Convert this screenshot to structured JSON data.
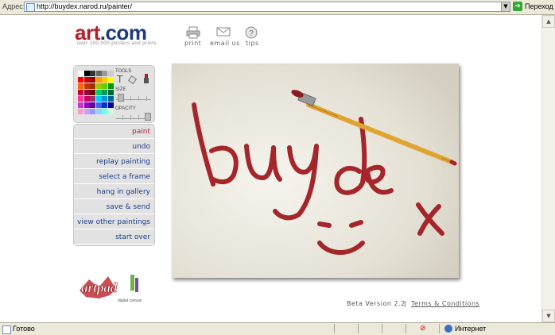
{
  "browser": {
    "address_label": "Адрес:",
    "url": "http://buydex.narod.ru/painter/",
    "go_label": "Переход",
    "status_text": "Готово",
    "zone_text": "Интернет"
  },
  "header": {
    "logo_art": "art",
    "logo_com": ".com",
    "logo_sub": "over 100,000 posters and prints",
    "links": [
      {
        "label": "print",
        "icon": "printer-icon"
      },
      {
        "label": "email us",
        "icon": "envelope-icon"
      },
      {
        "label": "tips",
        "icon": "question-icon"
      }
    ]
  },
  "tools": {
    "tools_label": "TOOLS",
    "size_label": "SIZE",
    "opacity_label": "OPACITY",
    "palette": [
      "#ffffff",
      "#000000",
      "#333333",
      "#666666",
      "#999999",
      "#cccccc",
      "#ff0000",
      "#cc0000",
      "#990000",
      "#ff9900",
      "#ffcc00",
      "#ffff00",
      "#ff6600",
      "#cc3300",
      "#993300",
      "#99cc00",
      "#66cc00",
      "#009900",
      "#cc0033",
      "#990033",
      "#660000",
      "#00cc66",
      "#009966",
      "#006633",
      "#ff3399",
      "#cc0066",
      "#993366",
      "#00ccff",
      "#0099cc",
      "#006699",
      "#cc33cc",
      "#9900cc",
      "#660099",
      "#3366ff",
      "#0033cc",
      "#000099",
      "#ff99cc",
      "#cc99ff",
      "#9999ff",
      "#99ccff",
      "#66ffff",
      "#ccffcc"
    ]
  },
  "menu": {
    "items": [
      {
        "label": "paint",
        "active": true
      },
      {
        "label": "undo"
      },
      {
        "label": "replay painting"
      },
      {
        "label": "select a frame"
      },
      {
        "label": "hang in gallery"
      },
      {
        "label": "save & send"
      },
      {
        "label": "view other paintings"
      },
      {
        "label": "start over"
      }
    ]
  },
  "artpad": {
    "brand": "artpad",
    "tagline": "digital canvas"
  },
  "canvas": {
    "painting_text": "buydex",
    "stroke_color": "#a5262a"
  },
  "footer": {
    "version": "Beta Version 2.2",
    "separator": "|",
    "terms_link": "Terms & Conditions"
  }
}
